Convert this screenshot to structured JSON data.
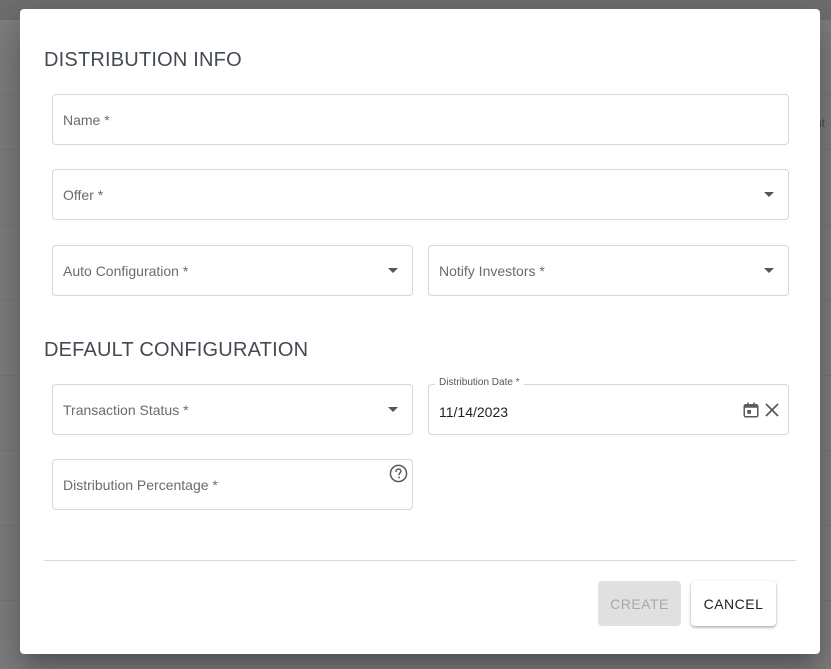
{
  "dialog": {
    "distribution_info_title": "DISTRIBUTION INFO",
    "default_configuration_title": "DEFAULT CONFIGURATION",
    "fields": {
      "name": {
        "placeholder": "Name *"
      },
      "offer": {
        "placeholder": "Offer *"
      },
      "auto_configuration": {
        "placeholder": "Auto Configuration *"
      },
      "notify_investors": {
        "placeholder": "Notify Investors *"
      },
      "transaction_status": {
        "placeholder": "Transaction Status *"
      },
      "distribution_date": {
        "label": "Distribution Date *",
        "value": "11/14/2023"
      },
      "distribution_percentage": {
        "placeholder": "Distribution Percentage *"
      }
    },
    "buttons": {
      "create": "CREATE",
      "cancel": "CANCEL"
    }
  },
  "backdrop": {
    "edge_text": "nt"
  },
  "icons": {
    "dropdown": "caret-down-icon",
    "calendar": "calendar-icon",
    "clear": "close-icon",
    "help": "help-circle-icon"
  },
  "colors": {
    "title_text": "#444a52",
    "border": "#d6d6d6",
    "disabled_button_bg": "#e0e0e0",
    "disabled_button_text": "#a8a8a8"
  }
}
